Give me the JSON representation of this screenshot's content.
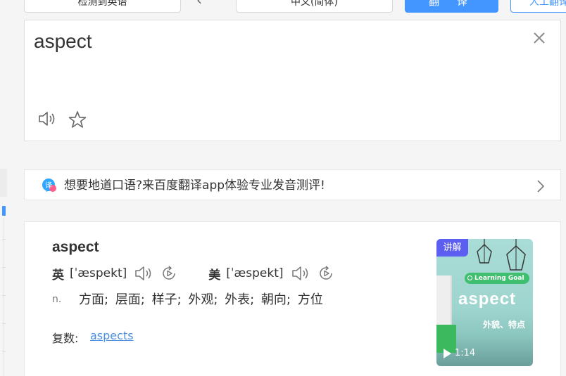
{
  "toolbar": {
    "source_lang": "检测到英语",
    "target_lang": "中文(简体)",
    "swap_glyph": "‹",
    "translate_label": "翻 译",
    "human_label": "人工翻译"
  },
  "input": {
    "text": "aspect"
  },
  "promo": {
    "text": "想要地道口语?来百度翻译app体验专业发音测评!"
  },
  "result": {
    "word": "aspect",
    "uk_label": "英",
    "uk_phonetic": "[ˈæspekt]",
    "us_label": "美",
    "us_phonetic": "[ˈæspekt]",
    "pos": "n.",
    "definitions": "方面;  层面;  样子;  外观;  外表;  朝向;  方位",
    "plural_label": "复数:",
    "plural_value": "aspects"
  },
  "video": {
    "badge": "讲解",
    "goal": "Learning Goal",
    "word": "aspect",
    "subtitle": "外貌、特点",
    "duration": "1:14"
  },
  "colors": {
    "accent": "#4395ff",
    "link": "#4a90e2",
    "badge": "#5b5ef0"
  }
}
